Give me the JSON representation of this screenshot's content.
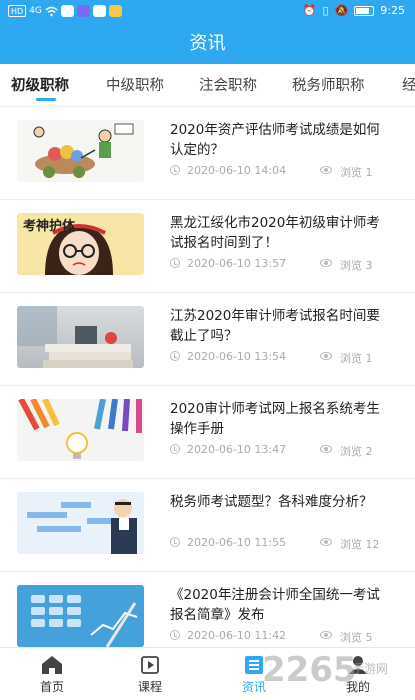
{
  "status_bar": {
    "carrier_chip": "HD",
    "signal": "4G",
    "time": "9:25",
    "icons": [
      "hd-icon",
      "signal-icon",
      "wifi-icon",
      "app-notification-icons",
      "alarm-icon",
      "vibrate-icon",
      "mute-icon",
      "battery-icon"
    ]
  },
  "header": {
    "title": "资讯"
  },
  "tabs": [
    {
      "label": "初级职称",
      "active": true
    },
    {
      "label": "中级职称"
    },
    {
      "label": "注会职称"
    },
    {
      "label": "税务师职称"
    },
    {
      "label": "经"
    }
  ],
  "articles": [
    {
      "title": "2020年资产评估师考试成绩是如何认定的？",
      "date": "2020-06-10 14:04",
      "views_label": "浏览",
      "views": "1",
      "thumb": "cartoon-cart-illustration"
    },
    {
      "title": "黑龙江绥化市2020年初级审计师考试报名时间到了！",
      "date": "2020-06-10 13:57",
      "views_label": "浏览",
      "views": "3",
      "thumb": "cartoon-girl-glasses",
      "thumb_text": "考神护体"
    },
    {
      "title": "江苏2020年审计师考试报名时间要截止了吗？",
      "date": "2020-06-10 13:54",
      "views_label": "浏览",
      "views": "1",
      "thumb": "books-desk-photo"
    },
    {
      "title": "2020审计师考试网上报名系统考生操作手册",
      "date": "2020-06-10 13:47",
      "views_label": "浏览",
      "views": "2",
      "thumb": "pencils-lightbulb"
    },
    {
      "title": "税务师考试题型？各科难度分析？",
      "date": "2020-06-10 11:55",
      "views_label": "浏览",
      "views": "12",
      "thumb": "man-glasses-diagram"
    },
    {
      "title": "《2020年注册会计师全国统一考试报名简章》发布",
      "date": "2020-06-10 11:42",
      "views_label": "浏览",
      "views": "5",
      "thumb": "calculator-chart"
    }
  ],
  "bottom_nav": [
    {
      "label": "首页",
      "icon": "home-icon"
    },
    {
      "label": "课程",
      "icon": "video-icon"
    },
    {
      "label": "资讯",
      "icon": "news-icon",
      "active": true
    },
    {
      "label": "我的",
      "icon": "user-icon"
    }
  ],
  "watermark": {
    "text": "2265",
    "sub": "手游网"
  },
  "colors": {
    "primary": "#2ea8f0",
    "text": "#222222",
    "meta": "#aaaaaa"
  }
}
